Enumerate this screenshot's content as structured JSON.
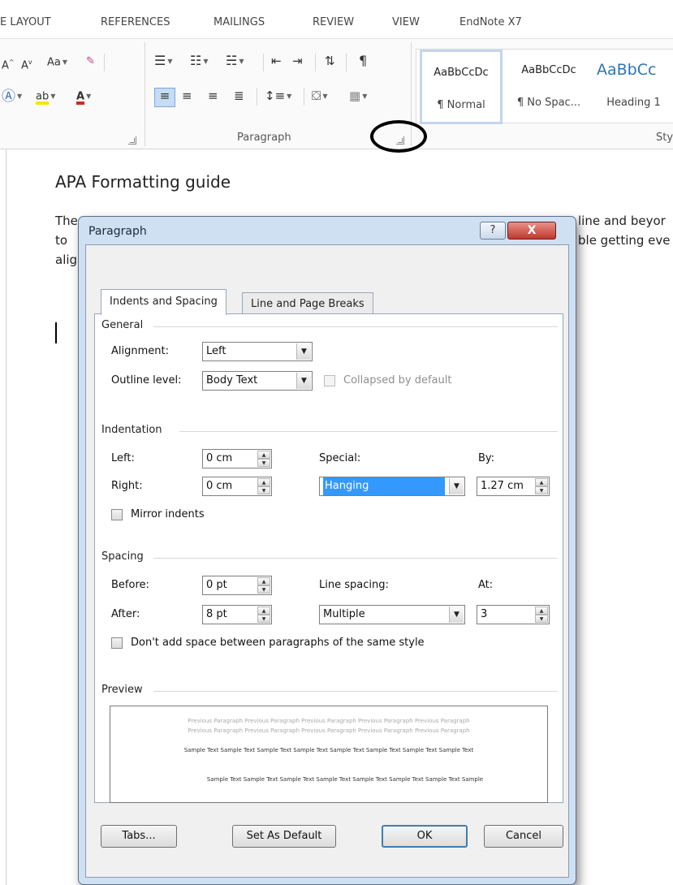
{
  "ribbon": {
    "tabs": [
      "E LAYOUT",
      "REFERENCES",
      "MAILINGS",
      "REVIEW",
      "VIEW",
      "EndNote X7"
    ],
    "font_row1": [
      "A˄",
      "A˅",
      "Aa",
      "♦"
    ],
    "paragraph_label": "Paragraph",
    "styles_label": "Sty",
    "styles": [
      {
        "sample": "AaBbCcDc",
        "label": "¶ Normal"
      },
      {
        "sample": "AaBbCcDc",
        "label": "¶ No Spac..."
      },
      {
        "sample": "AaBbCc",
        "label": "Heading 1"
      }
    ],
    "accent": "#2b579a"
  },
  "document": {
    "title": "APA Formatting guide",
    "lines": [
      "The",
      "to",
      "alig"
    ],
    "right_lines": [
      "line and beyor",
      "ble getting eve"
    ]
  },
  "dialog": {
    "title": "Paragraph",
    "help_label": "?",
    "close_label": "X",
    "tabs": [
      "Indents and Spacing",
      "Line and Page Breaks"
    ],
    "general": {
      "heading": "General",
      "alignment_label": "Alignment:",
      "alignment_value": "Left",
      "outline_label": "Outline level:",
      "outline_value": "Body Text",
      "collapsed_label": "Collapsed by default"
    },
    "indentation": {
      "heading": "Indentation",
      "left_label": "Left:",
      "left_value": "0 cm",
      "right_label": "Right:",
      "right_value": "0 cm",
      "special_label": "Special:",
      "special_value": "Hanging",
      "by_label": "By:",
      "by_value": "1.27 cm",
      "mirror_label": "Mirror indents"
    },
    "spacing": {
      "heading": "Spacing",
      "before_label": "Before:",
      "before_value": "0 pt",
      "after_label": "After:",
      "after_value": "8 pt",
      "line_spacing_label": "Line spacing:",
      "line_spacing_value": "Multiple",
      "at_label": "At:",
      "at_value": "3",
      "dont_add_label": "Don't add space between paragraphs of the same style"
    },
    "preview": {
      "heading": "Preview",
      "prev_line1": "Previous Paragraph Previous Paragraph Previous Paragraph Previous Paragraph Previous Paragraph",
      "prev_line2": "Previous Paragraph Previous Paragraph Previous Paragraph Previous Paragraph Previous Paragraph",
      "sample_line1": "Sample Text Sample Text Sample Text Sample Text Sample Text Sample Text Sample Text Sample Text",
      "sample_line2": "Sample Text Sample Text Sample Text Sample Text Sample Text Sample Text Sample Text Sample"
    },
    "buttons": {
      "tabs": "Tabs...",
      "set_default": "Set As Default",
      "ok": "OK",
      "cancel": "Cancel"
    },
    "selection_color": "#3399ff"
  }
}
